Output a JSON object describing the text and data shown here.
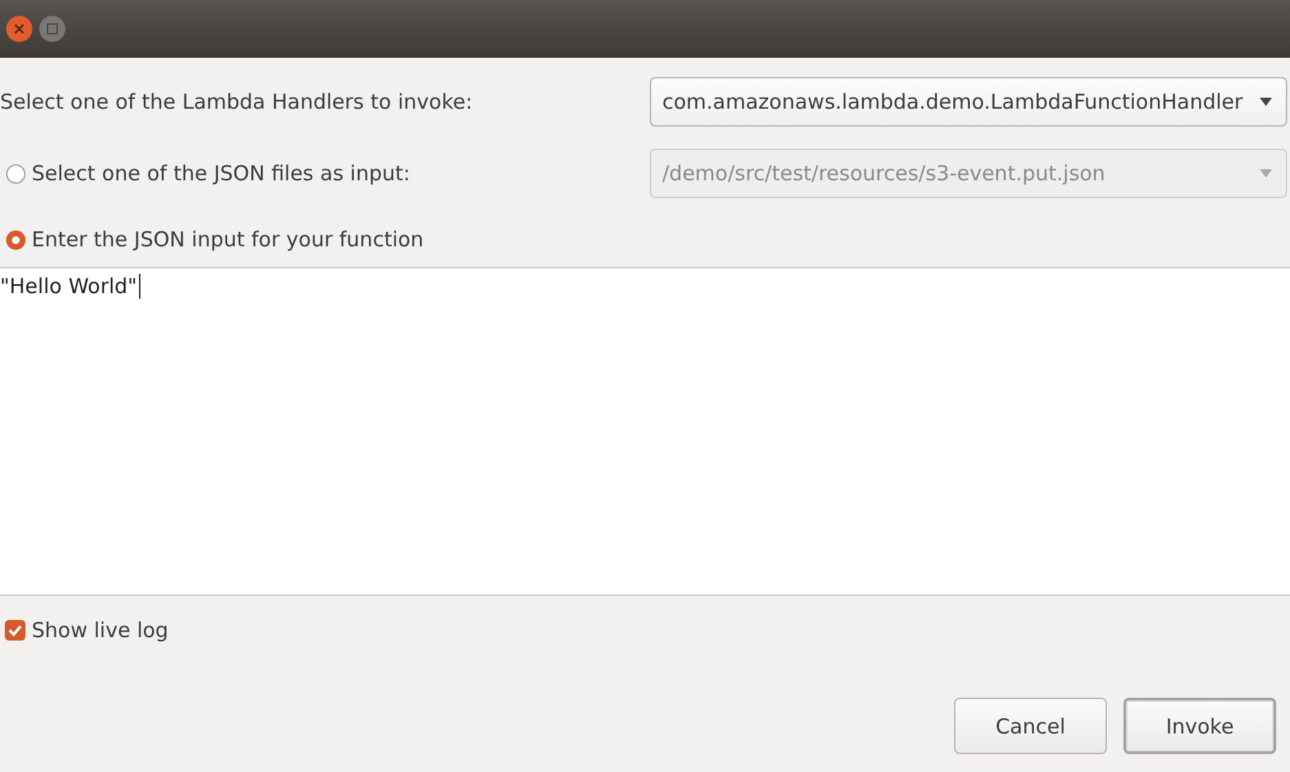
{
  "handler": {
    "label": "Select one of the Lambda Handlers to invoke:",
    "value": "com.amazonaws.lambda.demo.LambdaFunctionHandler",
    "disabled": false
  },
  "input_modes": [
    {
      "label": "Select one of the JSON files as input:",
      "selected": false,
      "file": {
        "value": "/demo/src/test/resources/s3-event.put.json",
        "disabled": true
      }
    },
    {
      "label": "Enter the JSON input for your function",
      "selected": true
    }
  ],
  "json_input": {
    "value": "\"Hello World\""
  },
  "show_live_log": {
    "label": "Show live log",
    "checked": true
  },
  "buttons": [
    {
      "label": "Cancel",
      "default": false
    },
    {
      "label": "Invoke",
      "default": true
    }
  ]
}
